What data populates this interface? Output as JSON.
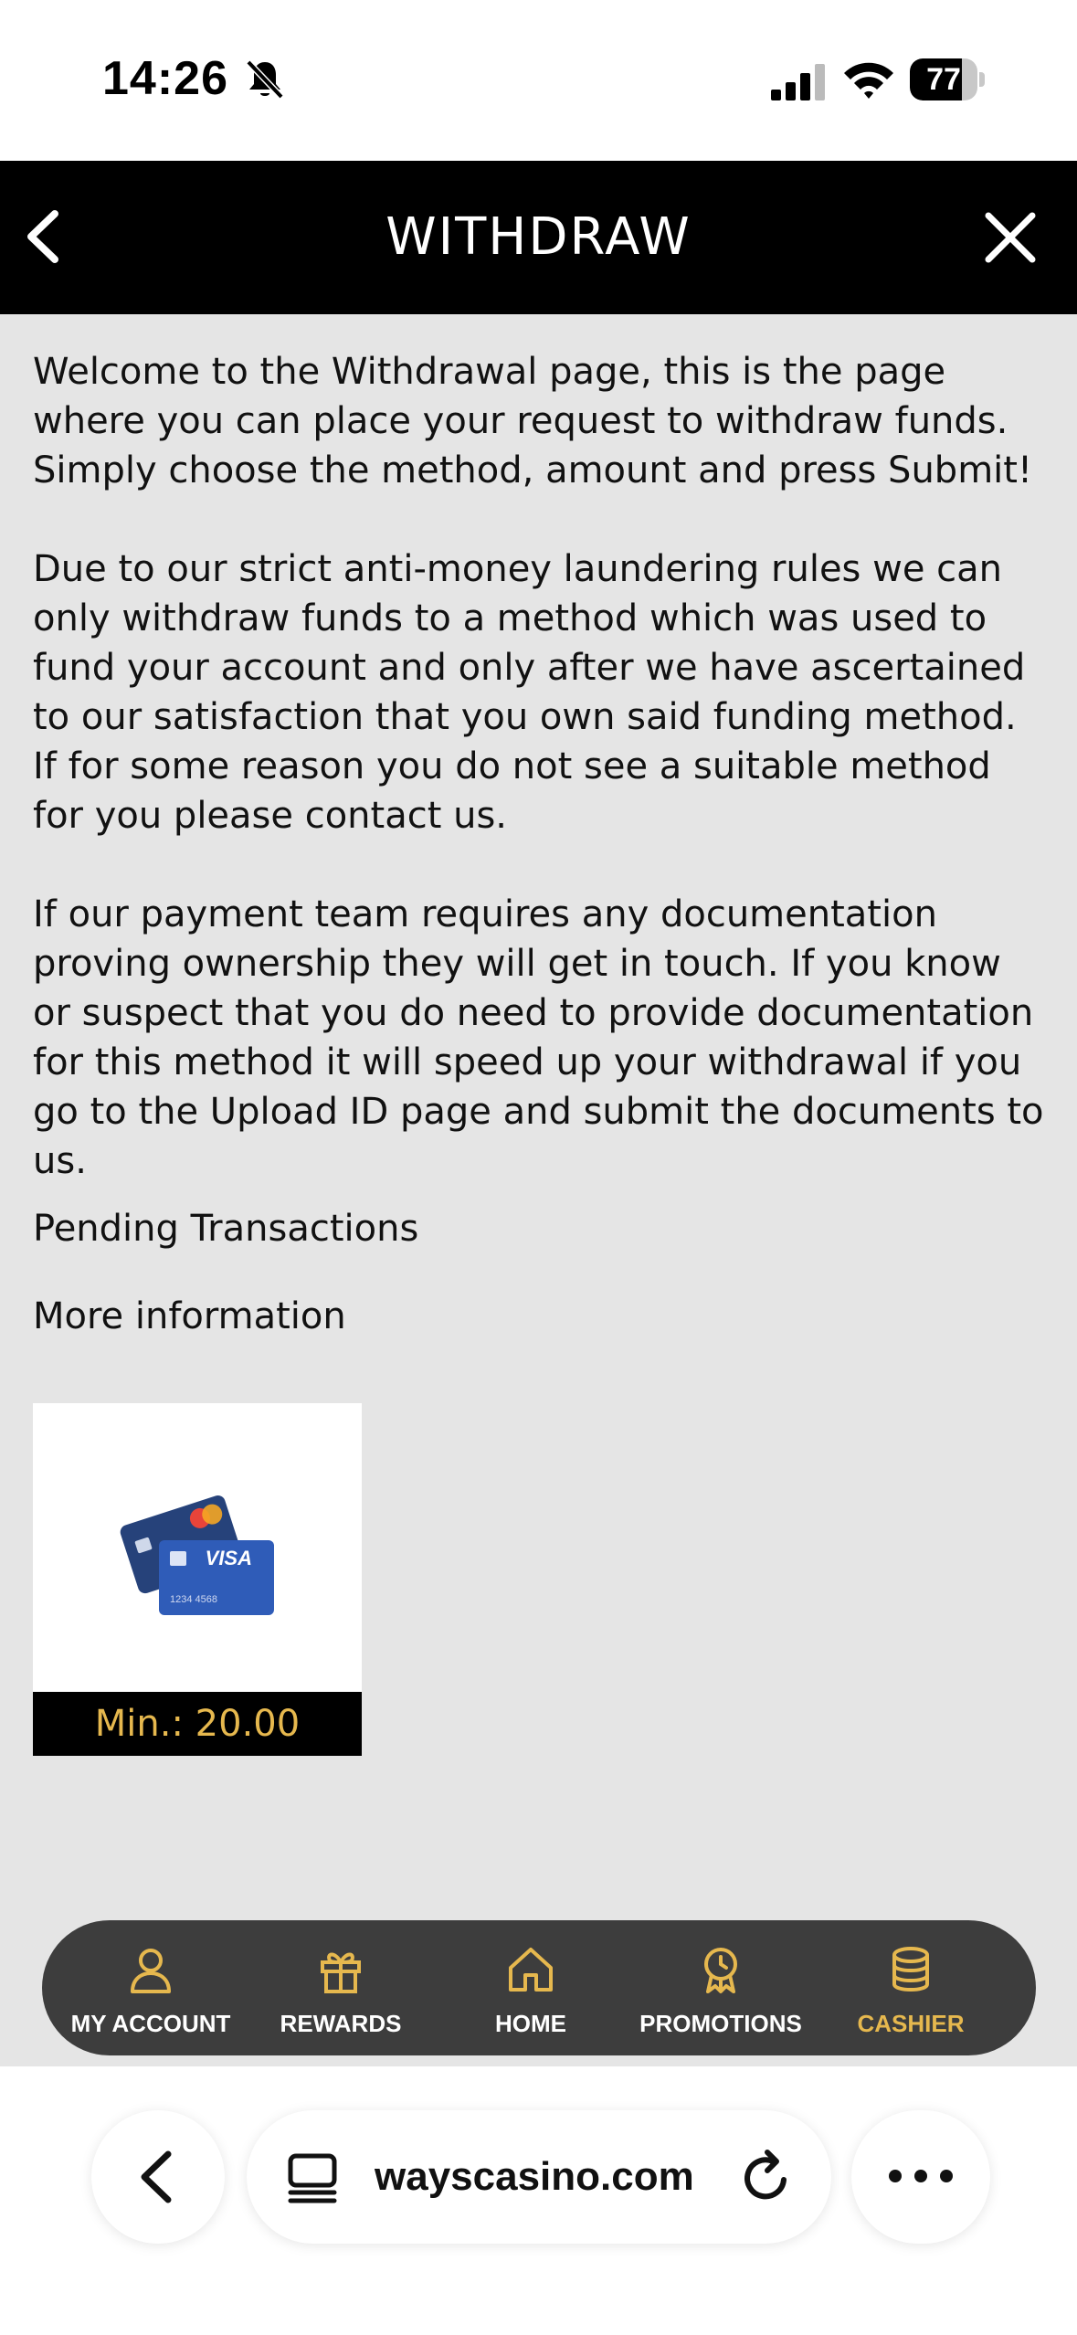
{
  "status": {
    "time": "14:26",
    "battery": "77",
    "battery_level": 77
  },
  "header": {
    "title": "WITHDRAW"
  },
  "content": {
    "paragraph1": "Welcome to the Withdrawal page, this is the page where you can place your request to withdraw funds. Simply choose the method, amount and press Submit!",
    "paragraph2": "Due to our strict anti-money laundering rules we can only withdraw funds to a method which was used to fund your account and only after we have ascertained to our satisfaction that you own said funding method. If for some reason you do not see a suitable method for you please contact us.",
    "paragraph3": "If our payment team requires any documentation proving ownership they will get in touch. If you know or suspect that you do need to provide documentation for this method it will speed up your withdrawal if you go to the Upload ID page and submit the documents to us.",
    "pending_link": "Pending Transactions",
    "more_info_link": "More information",
    "method": {
      "icon": "credit-cards-icon",
      "min_label": "Min.: 20.00"
    }
  },
  "nav": {
    "items": [
      {
        "label": "MY ACCOUNT",
        "icon": "user-icon"
      },
      {
        "label": "REWARDS",
        "icon": "gift-icon"
      },
      {
        "label": "HOME",
        "icon": "home-icon"
      },
      {
        "label": "PROMOTIONS",
        "icon": "badge-icon"
      },
      {
        "label": "CASHIER",
        "icon": "coins-icon",
        "active": true
      }
    ],
    "accent": "#e6b84e"
  },
  "browser": {
    "url": "wayscasino.com"
  }
}
